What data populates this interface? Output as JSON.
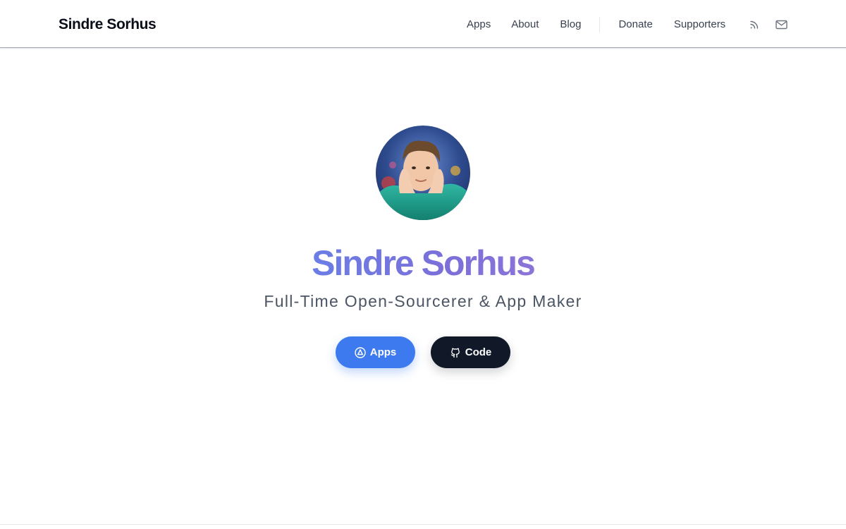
{
  "header": {
    "brand": "Sindre Sorhus",
    "nav": {
      "apps": "Apps",
      "about": "About",
      "blog": "Blog",
      "donate": "Donate",
      "supporters": "Supporters"
    },
    "icons": {
      "rss": "rss-icon",
      "mail": "mail-icon"
    }
  },
  "hero": {
    "name": "Sindre Sorhus",
    "tagline": "Full-Time Open-Sourcerer & App Maker",
    "buttons": {
      "apps": {
        "label": "Apps",
        "icon": "app-store-icon"
      },
      "code": {
        "label": "Code",
        "icon": "github-icon"
      }
    }
  },
  "colors": {
    "name_gradient_start": "#6a7ee6",
    "name_gradient_end": "#8b74d8",
    "apps_button": "#3d7af0",
    "code_button": "#111827",
    "text_muted": "#4b5563"
  }
}
